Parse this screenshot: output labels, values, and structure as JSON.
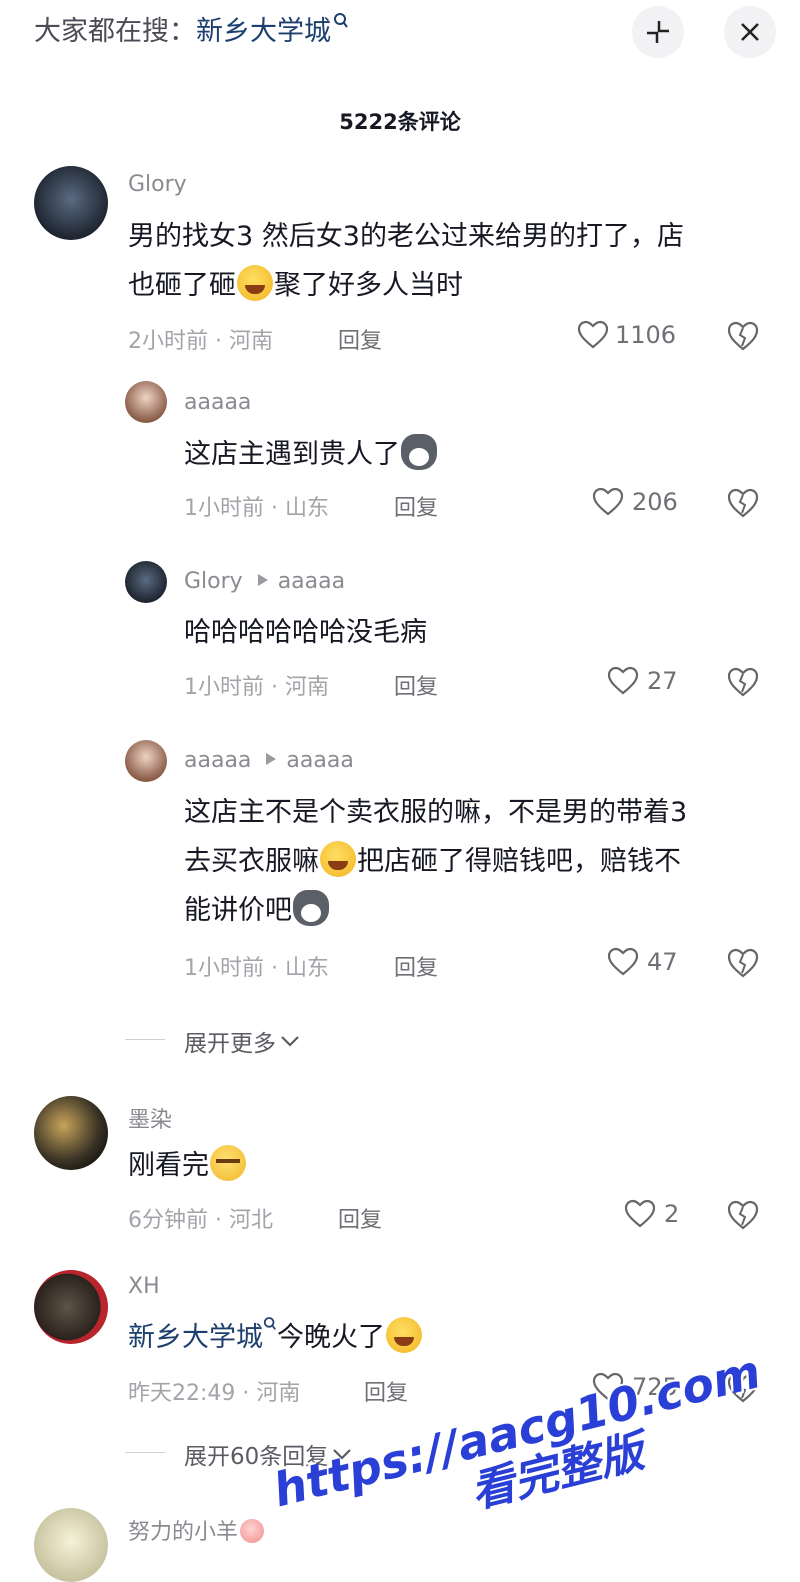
{
  "header": {
    "search_prefix": "大家都在搜：",
    "search_term": "新乡大学城"
  },
  "title": "5222条评论",
  "comments": [
    {
      "user": "Glory",
      "text_1": "男的找女3 然后女3的老公过来给男的打了，店",
      "text_2a": "也砸了砸",
      "text_2b": "聚了好多人当时",
      "time": "2小时前",
      "location": "河南",
      "reply_label": "回复",
      "likes": "1106"
    },
    {
      "user": "aaaaa",
      "text_1": "这店主遇到贵人了",
      "time": "1小时前",
      "location": "山东",
      "reply_label": "回复",
      "likes": "206"
    },
    {
      "user": "Glory",
      "reply_to": "aaaaa",
      "text_1": "哈哈哈哈哈哈没毛病",
      "time": "1小时前",
      "location": "河南",
      "reply_label": "回复",
      "likes": "27"
    },
    {
      "user": "aaaaa",
      "reply_to": "aaaaa",
      "text_1": "这店主不是个卖衣服的嘛，不是男的带着3",
      "text_2a": "去买衣服嘛",
      "text_2b": "把店砸了得赔钱吧，赔钱不",
      "text_3": "能讲价吧",
      "time": "1小时前",
      "location": "山东",
      "reply_label": "回复",
      "likes": "47"
    },
    {
      "user": "墨染",
      "text_1": "刚看完",
      "time": "6分钟前",
      "location": "河北",
      "reply_label": "回复",
      "likes": "2"
    },
    {
      "user": "XH",
      "link_text": "新乡大学城",
      "text_1": "今晚火了",
      "time": "昨天22:49",
      "location": "河南",
      "reply_label": "回复",
      "likes": "725"
    },
    {
      "user": "努力的小羊"
    }
  ],
  "expand_more": "展开更多",
  "expand_replies": "展开60条回复",
  "separator": "·",
  "watermark": {
    "line1": "https://aacg10.com",
    "line2": "看完整版"
  },
  "icons": [
    "search-icon",
    "collapse-icon",
    "close-icon",
    "heart-icon",
    "broken-heart-icon",
    "chevron-down-icon"
  ],
  "colors": {
    "link": "#1d3f6e",
    "watermark": "#2a3fd6",
    "text": "#161823",
    "meta": "#a3a4a9"
  }
}
